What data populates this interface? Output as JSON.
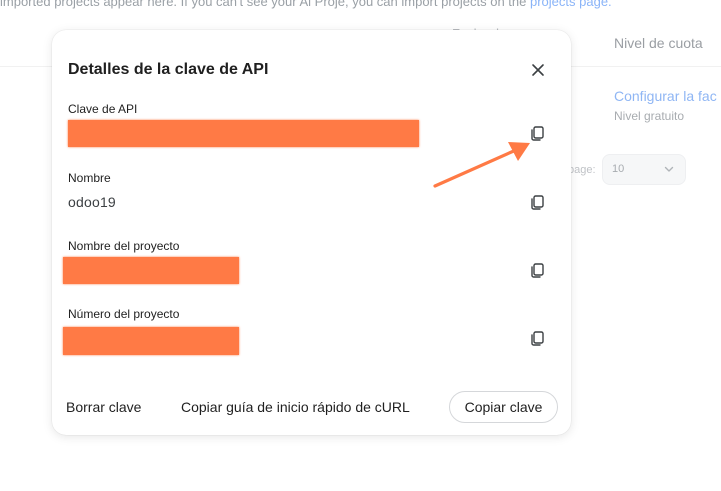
{
  "background": {
    "top_text": "imported projects appear here. If you can't see your Ai Proje, you can import projects on the",
    "top_link": "projects page.",
    "columns": {
      "created": "Fecha de",
      "quota_tier": "Nivel de cuota"
    },
    "row": {
      "link": "Configurar la fac",
      "tier": "Nivel gratuito"
    },
    "pagination": {
      "per_page_label": "page:",
      "per_page_value": "10"
    }
  },
  "dialog": {
    "title": "Detalles de la clave de API",
    "fields": [
      {
        "label": "Clave de API",
        "value": ""
      },
      {
        "label": "Nombre",
        "value": "odoo19"
      },
      {
        "label": "Nombre del proyecto",
        "value": ""
      },
      {
        "label": "Número del proyecto",
        "value": ""
      }
    ],
    "buttons": {
      "delete": "Borrar clave",
      "copy_curl": "Copiar guía de inicio rápido de cURL",
      "copy_key": "Copiar clave"
    }
  },
  "annotation": {
    "color": "#ff7a45",
    "redaction_color": "#ff7a45"
  },
  "icons": {
    "close": "close-icon",
    "copy": "copy-icon",
    "chevron": "chevron-down-icon"
  }
}
